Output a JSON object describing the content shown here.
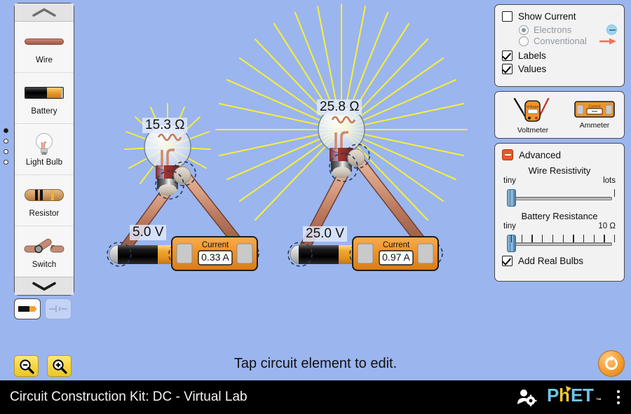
{
  "app": {
    "title": "Circuit Construction Kit: DC - Virtual Lab",
    "hint": "Tap circuit element to edit."
  },
  "toolbox": {
    "scroll_up_icon": "chevron-up-icon",
    "scroll_down_icon": "chevron-down-icon",
    "items": [
      {
        "label": "Wire",
        "icon": "wire-icon"
      },
      {
        "label": "Battery",
        "icon": "battery-icon"
      },
      {
        "label": "Light Bulb",
        "icon": "light-bulb-icon"
      },
      {
        "label": "Resistor",
        "icon": "resistor-icon"
      },
      {
        "label": "Switch",
        "icon": "switch-icon"
      }
    ],
    "page_dots": 4,
    "active_page": 1
  },
  "view_toggle": {
    "lifelike": {
      "icon": "lifelike-battery-icon",
      "selected": true
    },
    "schematic": {
      "icon": "schematic-battery-icon",
      "selected": false
    }
  },
  "zoom_controls": {
    "zoom_out": "zoom-out-icon",
    "zoom_in": "zoom-in-icon"
  },
  "reset": {
    "icon": "reset-all-icon",
    "color": "#f29a2e"
  },
  "display_panel": {
    "show_current": {
      "label": "Show Current",
      "checked": false
    },
    "current_type": [
      {
        "label": "Electrons",
        "selected": true,
        "indicator": "electron-icon"
      },
      {
        "label": "Conventional",
        "selected": false,
        "indicator": "arrow-right-icon"
      }
    ],
    "labels": {
      "label": "Labels",
      "checked": true
    },
    "values": {
      "label": "Values",
      "checked": true
    }
  },
  "meters_panel": {
    "voltmeter": {
      "label": "Voltmeter",
      "readout": "Voltage"
    },
    "ammeter": {
      "label": "Ammeter",
      "readout": "Current"
    }
  },
  "advanced_panel": {
    "title": "Advanced",
    "expanded": true,
    "wire_resistivity": {
      "title": "Wire Resistivity",
      "min_label": "tiny",
      "max_label": "lots",
      "value_pct": 0
    },
    "battery_resistance": {
      "title": "Battery Resistance",
      "min_label": "tiny",
      "max_label": "10 Ω",
      "value_pct": 0,
      "ticks": 11
    },
    "add_real_bulbs": {
      "label": "Add Real Bulbs",
      "checked": true
    }
  },
  "circuits": [
    {
      "name": "left-circuit",
      "bulb_resistance": "15.3 Ω",
      "battery_voltage": "5.0 V",
      "ammeter_label": "Current",
      "ammeter_value": "0.33 A",
      "brightness": "dim"
    },
    {
      "name": "right-circuit",
      "bulb_resistance": "25.8 Ω",
      "battery_voltage": "25.0 V",
      "ammeter_label": "Current",
      "ammeter_value": "0.97 A",
      "brightness": "bright"
    }
  ],
  "footer": {
    "title": "Circuit Construction Kit: DC - Virtual Lab",
    "preferences_icon": "user-preferences-icon",
    "logo": "phet-logo",
    "menu_icon": "kebab-menu-icon"
  },
  "colors": {
    "background": "#9bb5ef",
    "ray": "#f5ef3a",
    "wire": "#c08268",
    "panel": "#f2f2f2",
    "accent_orange": "#f0932a"
  }
}
